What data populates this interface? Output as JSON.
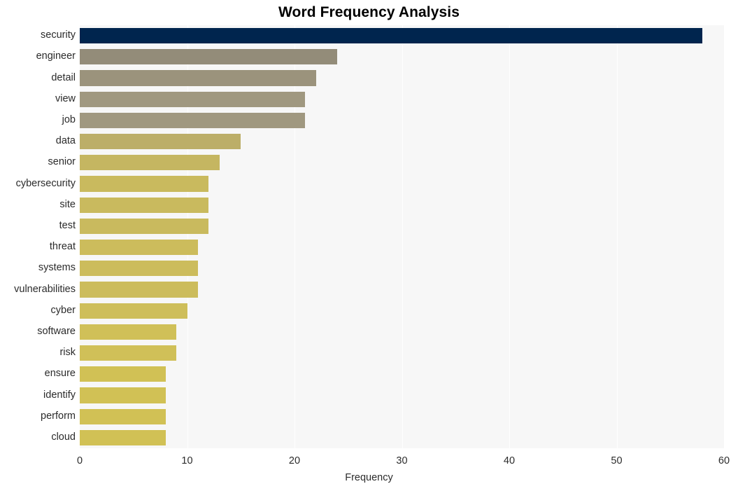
{
  "chart_data": {
    "type": "bar",
    "orientation": "horizontal",
    "title": "Word Frequency Analysis",
    "xlabel": "Frequency",
    "ylabel": "",
    "categories": [
      "security",
      "engineer",
      "detail",
      "view",
      "job",
      "data",
      "senior",
      "cybersecurity",
      "site",
      "test",
      "threat",
      "systems",
      "vulnerabilities",
      "cyber",
      "software",
      "risk",
      "ensure",
      "identify",
      "perform",
      "cloud"
    ],
    "values": [
      58,
      24,
      22,
      21,
      21,
      15,
      13,
      12,
      12,
      12,
      11,
      11,
      11,
      10,
      9,
      9,
      8,
      8,
      8,
      8
    ],
    "bar_colors": [
      "#00254e",
      "#938c79",
      "#9b937c",
      "#a09880",
      "#a09880",
      "#bcae68",
      "#c5b661",
      "#c9ba5e",
      "#c9ba5e",
      "#c9ba5e",
      "#ccbc5c",
      "#ccbc5c",
      "#ccbc5c",
      "#cebe5a",
      "#d0c058",
      "#d0c058",
      "#d1c155",
      "#d1c155",
      "#d1c155",
      "#d1c155"
    ],
    "xlim": [
      0,
      60
    ],
    "xticks": [
      0,
      10,
      20,
      30,
      40,
      50,
      60
    ],
    "xtick_labels": [
      "0",
      "10",
      "20",
      "30",
      "40",
      "50",
      "60"
    ],
    "grid": true,
    "grid_axis": "x",
    "legend": null,
    "plot_background": "#f7f7f7",
    "figure_background": "#ffffff",
    "gridline_color": "#ffffff",
    "title_color": "#000000",
    "tick_label_color": "#2b2b2b"
  }
}
